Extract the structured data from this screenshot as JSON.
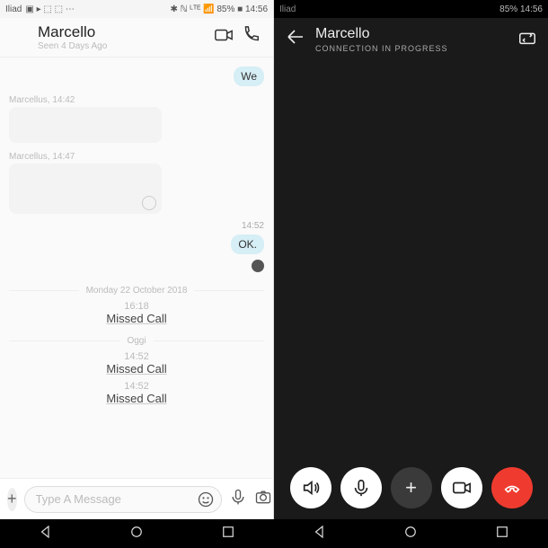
{
  "status_left": {
    "carrier": "Iliad",
    "icons": "▣ ▸ ⬚ ⬚ ⋯",
    "right": "✱ ℕ ᴸᵀᴱ 📶 85% ■ 14:56"
  },
  "status_right": {
    "carrier": "Iliad",
    "right": "85% 14:56"
  },
  "left": {
    "name": "Marcello",
    "seen": "Seen 4 Days Ago",
    "msg_we": "We",
    "meta1": "Marcellus, 14:42",
    "meta2": "Marcellus, 14:47",
    "ts1": "14:52",
    "msg_ok": "OK.",
    "date_div": "Monday 22 October 2018",
    "call1_t": "16:18",
    "call1_c": "Missed Call",
    "today_div": "Oggi",
    "call2_t": "14:52",
    "call2_c": "Missed Call",
    "call3_t": "14:52",
    "call3_c": "Missed Call",
    "placeholder": "Type A Message"
  },
  "right": {
    "name": "Marcello",
    "status": "CONNECTION IN PROGRESS"
  }
}
